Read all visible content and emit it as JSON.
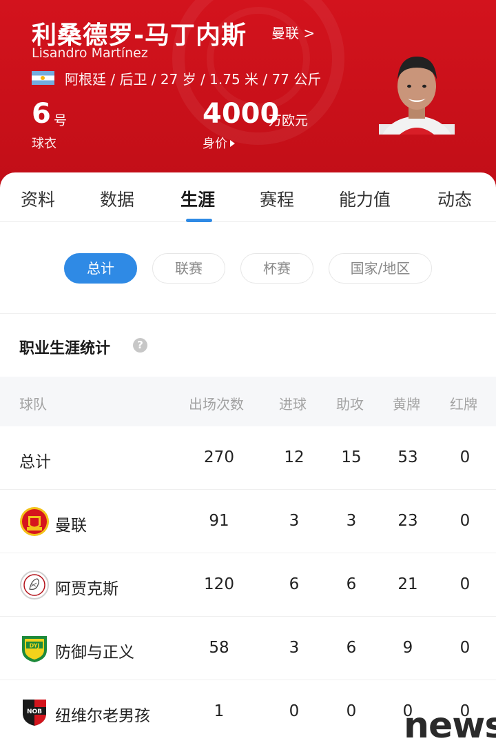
{
  "player": {
    "name_cn": "利桑德罗-马丁内斯",
    "name_en": "Lisandro Martínez",
    "team_link": "曼联 >",
    "info": "阿根廷 / 后卫 / 27 岁 / 1.75 米 / 77 公斤",
    "number": "6",
    "number_unit": "号",
    "number_label": "球衣",
    "value": "4000",
    "value_unit": "万欧元",
    "value_label": "身价"
  },
  "tabs": [
    "资料",
    "数据",
    "生涯",
    "赛程",
    "能力值",
    "动态"
  ],
  "active_tab": "生涯",
  "filters": [
    "总计",
    "联赛",
    "杯赛",
    "国家/地区"
  ],
  "section_title": "职业生涯统计",
  "table": {
    "headers": [
      "球队",
      "出场次数",
      "进球",
      "助攻",
      "黄牌",
      "红牌"
    ],
    "rows": [
      {
        "team": "总计",
        "apps": "270",
        "goals": "12",
        "assists": "15",
        "yellow": "53",
        "red": "0"
      },
      {
        "team": "曼联",
        "apps": "91",
        "goals": "3",
        "assists": "3",
        "yellow": "23",
        "red": "0"
      },
      {
        "team": "阿贾克斯",
        "apps": "120",
        "goals": "6",
        "assists": "6",
        "yellow": "21",
        "red": "0"
      },
      {
        "team": "防御与正义",
        "apps": "58",
        "goals": "3",
        "assists": "6",
        "yellow": "9",
        "red": "0"
      },
      {
        "team": "纽维尔老男孩",
        "apps": "1",
        "goals": "0",
        "assists": "0",
        "yellow": "0",
        "red": "0"
      }
    ]
  },
  "watermark": "news",
  "colors": {
    "header_red": "#c8101a",
    "accent_blue": "#2f8ae5"
  }
}
